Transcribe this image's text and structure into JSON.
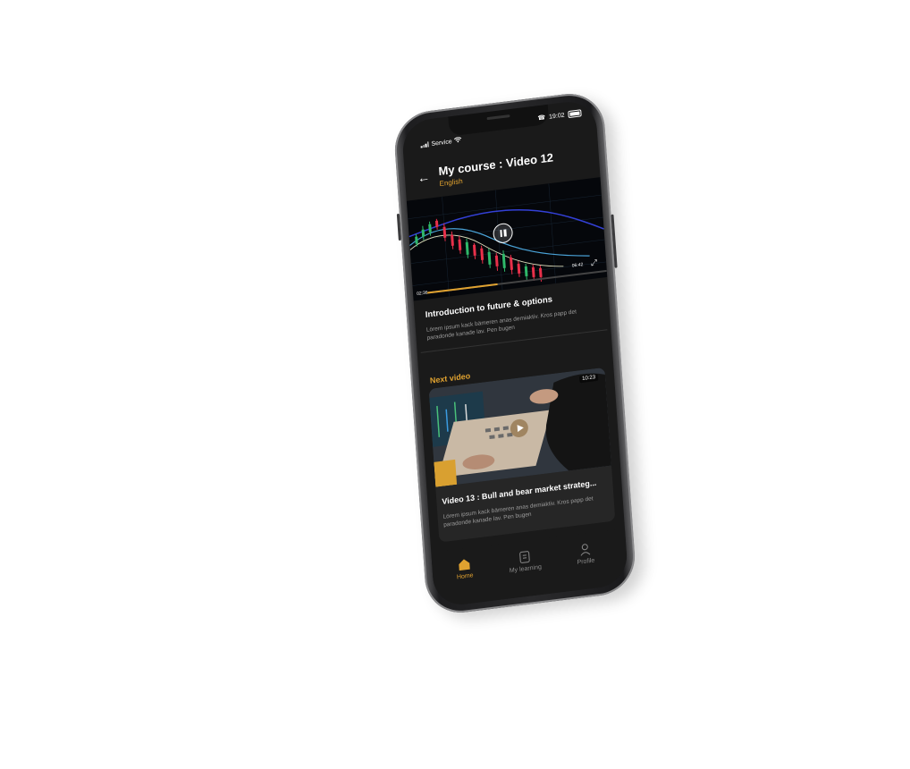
{
  "status_bar": {
    "carrier": "Service",
    "time": "19:02"
  },
  "header": {
    "title": "My course : Video 12",
    "language": "English"
  },
  "player": {
    "current_time": "02:36",
    "duration": "06:42",
    "progress": 0.39,
    "state": "playing"
  },
  "lesson": {
    "title": "Introduction to future & options",
    "description": "Lörem ipsum kack bämeren anas demiaktiv. Kros papp det paradonde kanade lav. Pen bugen"
  },
  "next_video": {
    "section_label": "Next video",
    "duration": "10:23",
    "title": "Video 13 : Bull and bear market strateg...",
    "description": "Lörem ipsum kack bämeren anas demiaktiv. Kros papp det paradonde kanade lav. Pen bugen"
  },
  "navbar": {
    "items": [
      {
        "label": "Home",
        "icon": "home-icon",
        "active": true
      },
      {
        "label": "My learning",
        "icon": "book-icon",
        "active": false
      },
      {
        "label": "Profile",
        "icon": "user-icon",
        "active": false
      }
    ]
  },
  "colors": {
    "accent": "#e0a230",
    "background": "#1a1a1a",
    "card": "#262626"
  }
}
